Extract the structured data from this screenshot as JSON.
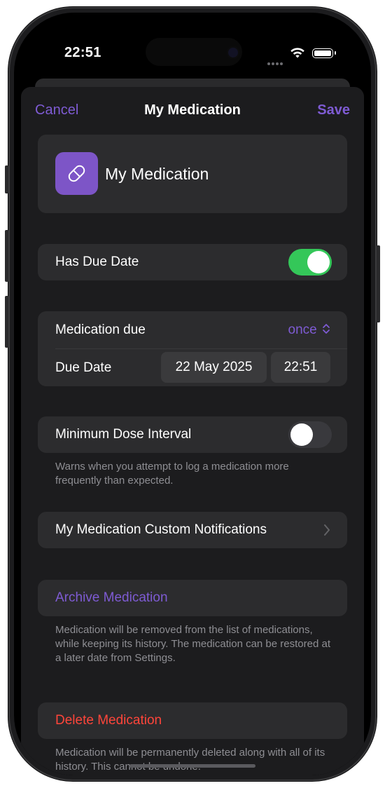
{
  "status": {
    "time": "22:51"
  },
  "nav": {
    "cancel": "Cancel",
    "title": "My Medication",
    "save": "Save"
  },
  "medication": {
    "name": "My Medication",
    "icon": "pill-icon",
    "icon_color": "#7d55c7"
  },
  "due_toggle": {
    "label": "Has Due Date",
    "on": true
  },
  "schedule": {
    "due_label": "Medication due",
    "due_value": "once",
    "date_label": "Due Date",
    "date_value": "22 May 2025",
    "time_value": "22:51"
  },
  "min_dose": {
    "label": "Minimum Dose Interval",
    "on": false,
    "note": "Warns when you attempt to log a medication more frequently than expected."
  },
  "notifications": {
    "label": "My Medication Custom Notifications"
  },
  "archive": {
    "label": "Archive Medication",
    "note": "Medication will be removed from the list of medications, while keeping its history. The medication can be restored at a later date from Settings."
  },
  "delete": {
    "label": "Delete Medication",
    "note": "Medication will be permanently deleted along with all of its history. This cannot be undone."
  },
  "colors": {
    "accent": "#7e5bd3",
    "toggle_on": "#34c759",
    "destructive": "#ff453a"
  }
}
